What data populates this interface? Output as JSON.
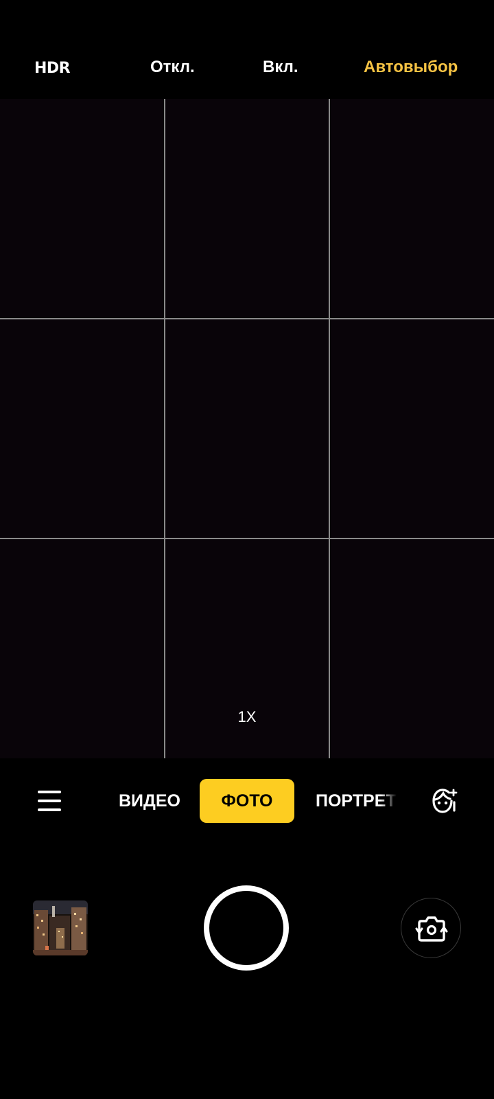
{
  "hdr_bar": {
    "label": "HDR",
    "options": {
      "off": "Откл.",
      "on": "Вкл.",
      "auto": "Автовыбор"
    },
    "selected": "auto",
    "selected_color": "#f6c344"
  },
  "viewfinder": {
    "grid": "3x3",
    "zoom": "1X"
  },
  "modes": {
    "video": "ВИДЕО",
    "photo": "ФОТО",
    "portrait": "ПОРТРЕТ",
    "selected": "photo",
    "accent_color": "#fdcd21"
  },
  "icons": {
    "menu": "menu-icon",
    "beauty": "beauty-face-icon",
    "switch_camera": "switch-camera-icon",
    "gallery": "gallery-thumbnail",
    "shutter": "shutter-button"
  }
}
